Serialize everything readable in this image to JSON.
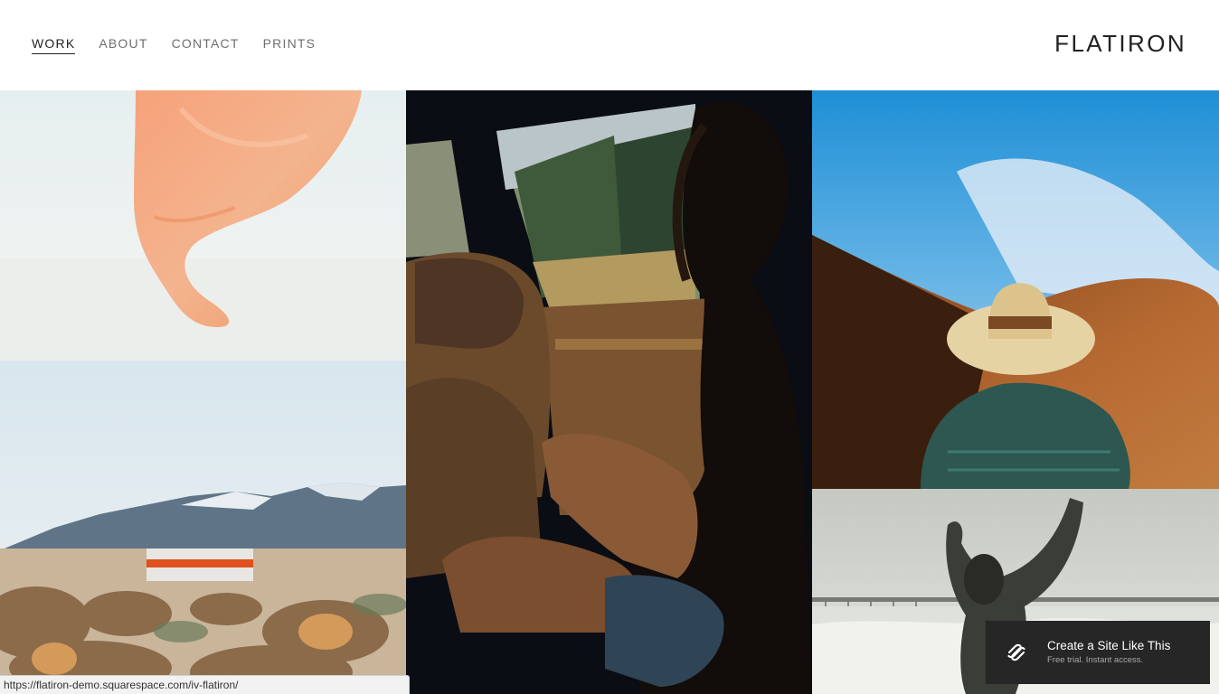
{
  "header": {
    "nav": [
      {
        "label": "WORK",
        "active": true
      },
      {
        "label": "ABOUT",
        "active": false
      },
      {
        "label": "CONTACT",
        "active": false
      },
      {
        "label": "PRINTS",
        "active": false
      }
    ],
    "logo": "FLATIRON"
  },
  "gallery": {
    "tiles": [
      {
        "subject": "orange fabric floating over white desert"
      },
      {
        "subject": "woman in car back seat by window"
      },
      {
        "subject": "man in straw hat facing brown hills under blue sky"
      },
      {
        "subject": "camper trailer in desert with snowy mountains"
      },
      {
        "subject": "woman splashing in ocean near pier"
      }
    ]
  },
  "promo": {
    "title": "Create a Site Like This",
    "subtitle": "Free trial. Instant access.",
    "icon": "squarespace-logo-icon",
    "background": "#262626"
  },
  "status_bar": {
    "url": "https://flatiron-demo.squarespace.com/iv-flatiron/"
  }
}
